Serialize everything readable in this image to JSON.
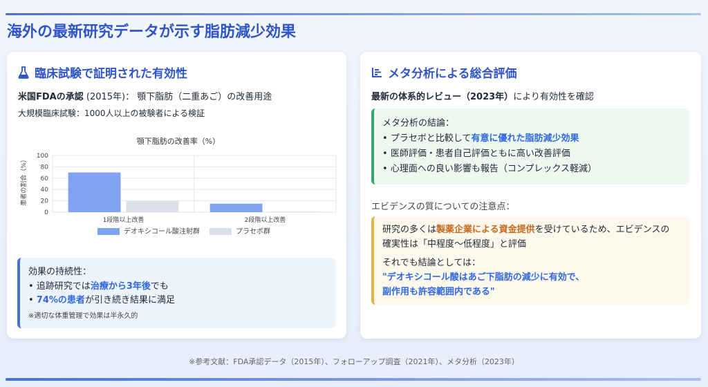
{
  "page": {
    "title": "海外の最新研究データが示す脂肪減少効果",
    "footer": "※参考文献：FDA承認データ（2015年）、フォローアップ調査（2021年）、メタ分析（2023年）"
  },
  "left": {
    "title": "臨床試験で証明された有効性",
    "approval_strong": "米国FDAの承認",
    "approval_rest": " (2015年)：  顎下脂肪（二重あご）の改善用途",
    "trial": "大規模臨床試験：1000人以上の被験者による検証",
    "durability": {
      "title": "効果の持続性：",
      "line1_pre": "• 追跡研究では",
      "line1_hl": "治療から3年後",
      "line1_post": "でも",
      "line2_pre": "• ",
      "line2_hl": "74%の患者",
      "line2_post": "が引き続き結果に満足",
      "note": "※適切な体重管理で効果は半永久的"
    }
  },
  "right": {
    "title": "メタ分析による総合評価",
    "review_strong": "最新の体系的レビュー（2023年）",
    "review_rest": "により有効性を確認",
    "conclusion": {
      "title": "メタ分析の結論：",
      "item1_pre": "プラセボと比較して",
      "item1_hl": "有意に優れた脂肪減少効果",
      "item2": "医師評価・患者自己評価ともに高い改善評価",
      "item3": "心理面への良い影響も報告（コンプレックス軽減）"
    },
    "caution_title": "エビデンスの質についての注意点：",
    "caution": {
      "line1_pre": "研究の多くは",
      "line1_hl": "製薬企業による資金提供",
      "line1_post": "を受けているため、エビデンスの",
      "line2": "確実性は「中程度〜低程度」と評価",
      "line3": "それでも結論としては：",
      "quote1": "\"デオキシコール酸はあご下脂肪の減少に有効で、",
      "quote2": "副作用も許容範囲内である\""
    }
  },
  "chart_data": {
    "type": "bar",
    "title": "顎下脂肪の改善率（%）",
    "ylabel": "患者の割合（%）",
    "xlabel": "",
    "categories": [
      "1段階以上改善",
      "2段階以上改善"
    ],
    "series": [
      {
        "name": "デオキシコール酸注射群",
        "values": [
          70,
          15
        ],
        "color": "#7fa2f0"
      },
      {
        "name": "プラセボ群",
        "values": [
          20,
          1
        ],
        "color": "#dcdfe5"
      }
    ],
    "ylim": [
      0,
      100
    ],
    "yticks": [
      0,
      20,
      40,
      60,
      80,
      100
    ],
    "grid": true,
    "legend": "bottom"
  }
}
